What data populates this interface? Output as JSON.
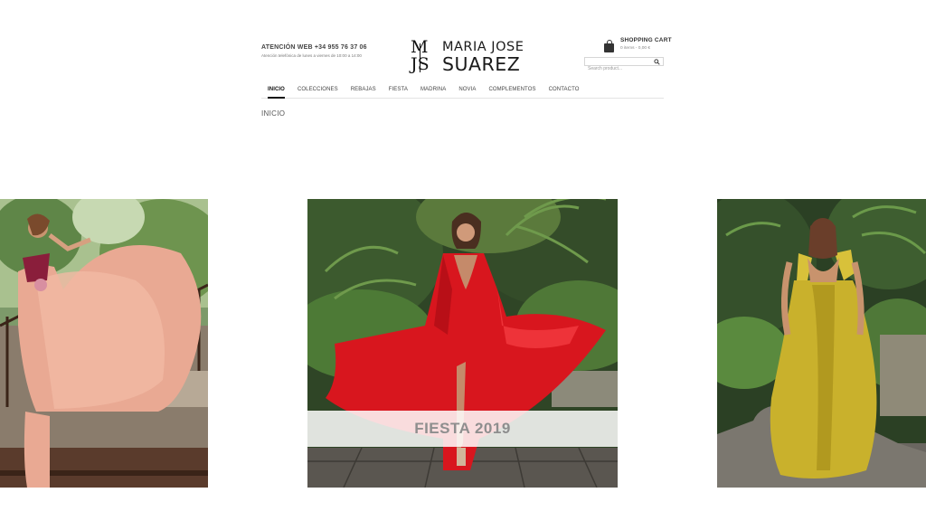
{
  "header": {
    "contact_phone": "ATENCIÓN WEB +34 955 76 37 06",
    "contact_hours": "Atención telefónica de lunes a viernes de 10:00 a 14:00",
    "logo_monogram_top": "M",
    "logo_monogram_bottom": "JS",
    "logo_line1": "MARIA JOSE",
    "logo_line2": "SUAREZ",
    "cart_title": "SHOPPING CART",
    "cart_summary": "0 items - 0,00 €",
    "search_placeholder": "Search product..."
  },
  "nav": {
    "items": [
      {
        "label": "INICIO",
        "active": true
      },
      {
        "label": "COLECCIONES",
        "active": false
      },
      {
        "label": "REBAJAS",
        "active": false
      },
      {
        "label": "FIESTA",
        "active": false
      },
      {
        "label": "MADRINA",
        "active": false
      },
      {
        "label": "NOVIA",
        "active": false
      },
      {
        "label": "COMPLEMENTOS",
        "active": false
      },
      {
        "label": "CONTACTO",
        "active": false
      }
    ]
  },
  "breadcrumb": "INICIO",
  "slider": {
    "center_caption": "FIESTA 2019",
    "slides": [
      {
        "position": "left",
        "dress_color": "#e9a993"
      },
      {
        "position": "center",
        "dress_color": "#d8161e"
      },
      {
        "position": "right",
        "dress_color": "#c9b12c"
      }
    ]
  },
  "colors": {
    "text_dark": "#111111",
    "caption_gray": "#8e8e8e",
    "nav_divider": "#e3e3e3"
  }
}
